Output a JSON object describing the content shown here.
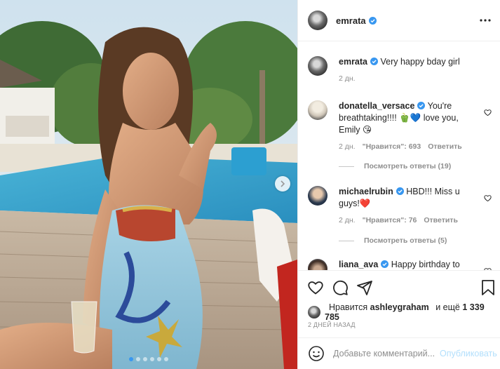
{
  "post": {
    "author": "emrata",
    "caption_user": "emrata",
    "caption_text": "Very happy bday girl",
    "caption_age": "2 дн.",
    "carousel": {
      "slides": 6,
      "active_index": 0
    }
  },
  "comments": [
    {
      "user": "donatella_versace",
      "text": "You're breathtaking!!!! 🫑💙 love you, Emily 😘",
      "age": "2 дн.",
      "likes": "\"Нравится\": 693",
      "reply": "Ответить",
      "view_replies": "Посмотреть ответы (19)"
    },
    {
      "user": "michaelrubin",
      "text": "HBD!!! Miss u guys!❤️",
      "age": "2 дн.",
      "likes": "\"Нравится\": 76",
      "reply": "Ответить",
      "view_replies": "Посмотреть ответы (5)"
    },
    {
      "user": "liana_ava",
      "text": "Happy birthday to"
    }
  ],
  "likes_line": {
    "prefix": "Нравится",
    "user": "ashleygraham",
    "middle": "и ещё",
    "count": "1 339 785"
  },
  "date": "2 ДНЕЙ НАЗАД",
  "composer": {
    "placeholder": "Добавьте комментарий...",
    "publish": "Опубликовать"
  },
  "icons": {
    "verified": "verified-badge-icon",
    "more": "more-options-icon",
    "like": "heart-icon",
    "comment": "comment-icon",
    "share": "paper-plane-icon",
    "save": "bookmark-icon",
    "emoji": "smiley-icon",
    "next": "chevron-right-icon"
  },
  "colors": {
    "accent": "#3897f0",
    "text": "#262626",
    "muted": "#8e8e8e",
    "publish_disabled": "#b2dffc"
  }
}
